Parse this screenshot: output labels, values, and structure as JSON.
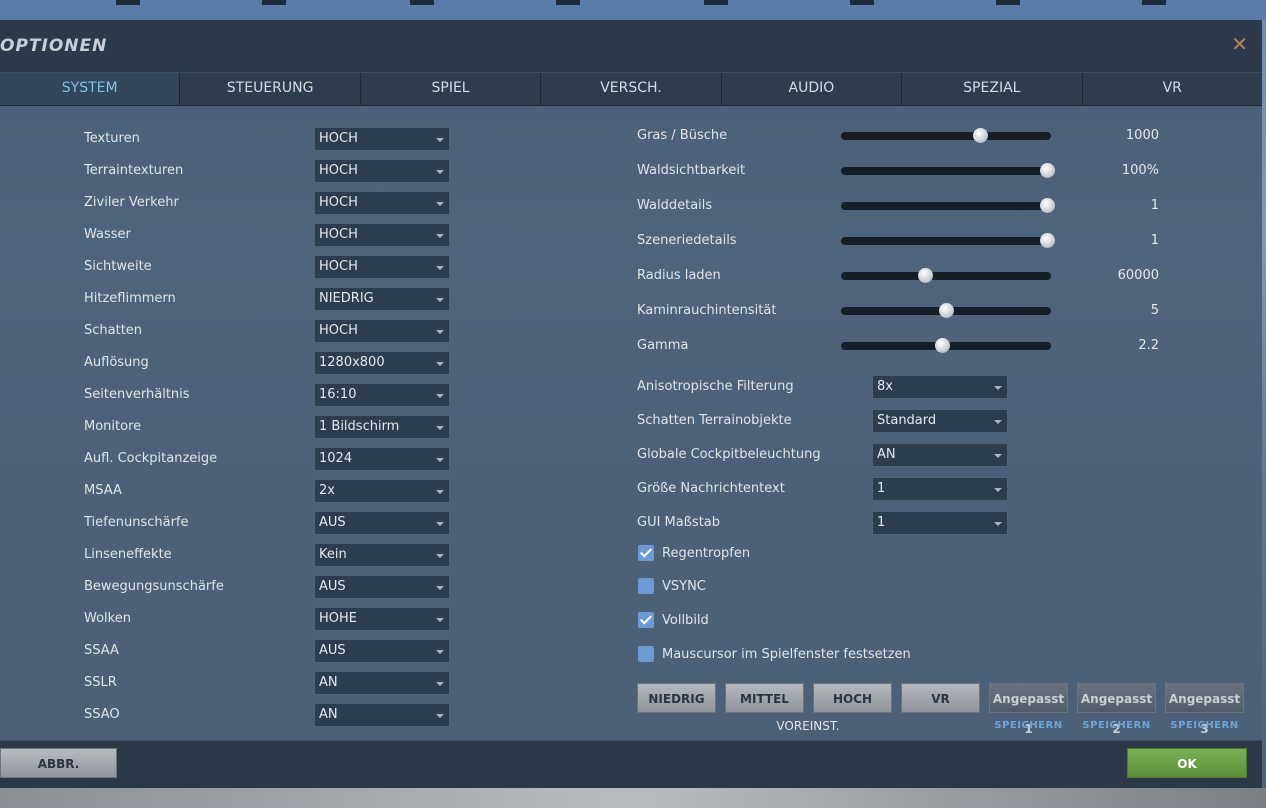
{
  "window": {
    "title": "OPTIONEN",
    "close_glyph": "✕"
  },
  "tabs": [
    {
      "label": "SYSTEM",
      "active": true
    },
    {
      "label": "STEUERUNG"
    },
    {
      "label": "SPIEL"
    },
    {
      "label": "VERSCH."
    },
    {
      "label": "AUDIO"
    },
    {
      "label": "SPEZIAL"
    },
    {
      "label": "VR"
    }
  ],
  "left_settings": [
    {
      "label": "Texturen",
      "value": "HOCH"
    },
    {
      "label": "Terraintexturen",
      "value": "HOCH"
    },
    {
      "label": "Ziviler Verkehr",
      "value": "HOCH"
    },
    {
      "label": "Wasser",
      "value": "HOCH"
    },
    {
      "label": "Sichtweite",
      "value": "HOCH"
    },
    {
      "label": "Hitzeflimmern",
      "value": "NIEDRIG"
    },
    {
      "label": "Schatten",
      "value": "HOCH"
    },
    {
      "label": "Auflösung",
      "value": "1280x800"
    },
    {
      "label": "Seitenverhältnis",
      "value": "16:10"
    },
    {
      "label": "Monitore",
      "value": "1 Bildschirm"
    },
    {
      "label": "Aufl. Cockpitanzeige",
      "value": "1024"
    },
    {
      "label": "MSAA",
      "value": "2x"
    },
    {
      "label": "Tiefenunschärfe",
      "value": "AUS"
    },
    {
      "label": "Linseneffekte",
      "value": "Kein"
    },
    {
      "label": "Bewegungsunschärfe",
      "value": "AUS"
    },
    {
      "label": "Wolken",
      "value": "HOHE"
    },
    {
      "label": "SSAA",
      "value": "AUS"
    },
    {
      "label": "SSLR",
      "value": "AN"
    },
    {
      "label": "SSAO",
      "value": "AN"
    }
  ],
  "sliders": [
    {
      "label": "Gras / Büsche",
      "value": "1000",
      "level": 0.66
    },
    {
      "label": "Waldsichtbarkeit",
      "value": "100%",
      "level": 0.98
    },
    {
      "label": "Walddetails",
      "value": "1",
      "level": 0.98
    },
    {
      "label": "Szeneriedetails",
      "value": "1",
      "level": 0.98
    },
    {
      "label": "Radius laden",
      "value": "60000",
      "level": 0.4
    },
    {
      "label": "Kaminrauchintensität",
      "value": "5",
      "level": 0.5
    },
    {
      "label": "Gamma",
      "value": "2.2",
      "level": 0.48
    }
  ],
  "right_dropdowns": [
    {
      "label": "Anisotropische Filterung",
      "value": "8x"
    },
    {
      "label": "Schatten Terrainobjekte",
      "value": "Standard"
    },
    {
      "label": "Globale Cockpitbeleuchtung",
      "value": "AN"
    },
    {
      "label": "Größe Nachrichtentext",
      "value": "1"
    },
    {
      "label": "GUI Maßstab",
      "value": "1"
    }
  ],
  "checkboxes": [
    {
      "label": "Regentropfen",
      "checked": true
    },
    {
      "label": "VSYNC",
      "checked": false
    },
    {
      "label": "Vollbild",
      "checked": true
    },
    {
      "label": "Mauscursor im Spielfenster festsetzen",
      "checked": false
    }
  ],
  "presets": {
    "buttons": [
      "NIEDRIG",
      "MITTEL",
      "HOCH",
      "VR"
    ],
    "caption": "VOREINST.",
    "custom": [
      {
        "label": "Angepasst 1",
        "save": "SPEICHERN"
      },
      {
        "label": "Angepasst 2",
        "save": "SPEICHERN"
      },
      {
        "label": "Angepasst 3",
        "save": "SPEICHERN"
      }
    ]
  },
  "footer": {
    "cancel_label": "ABBR.",
    "ok_label": "OK"
  },
  "colors": {
    "accent_tab": "#7fc3e6",
    "ok_green": "#6da046",
    "checkbox_blue": "#6e9ad3",
    "close_orange": "#b5825f"
  }
}
